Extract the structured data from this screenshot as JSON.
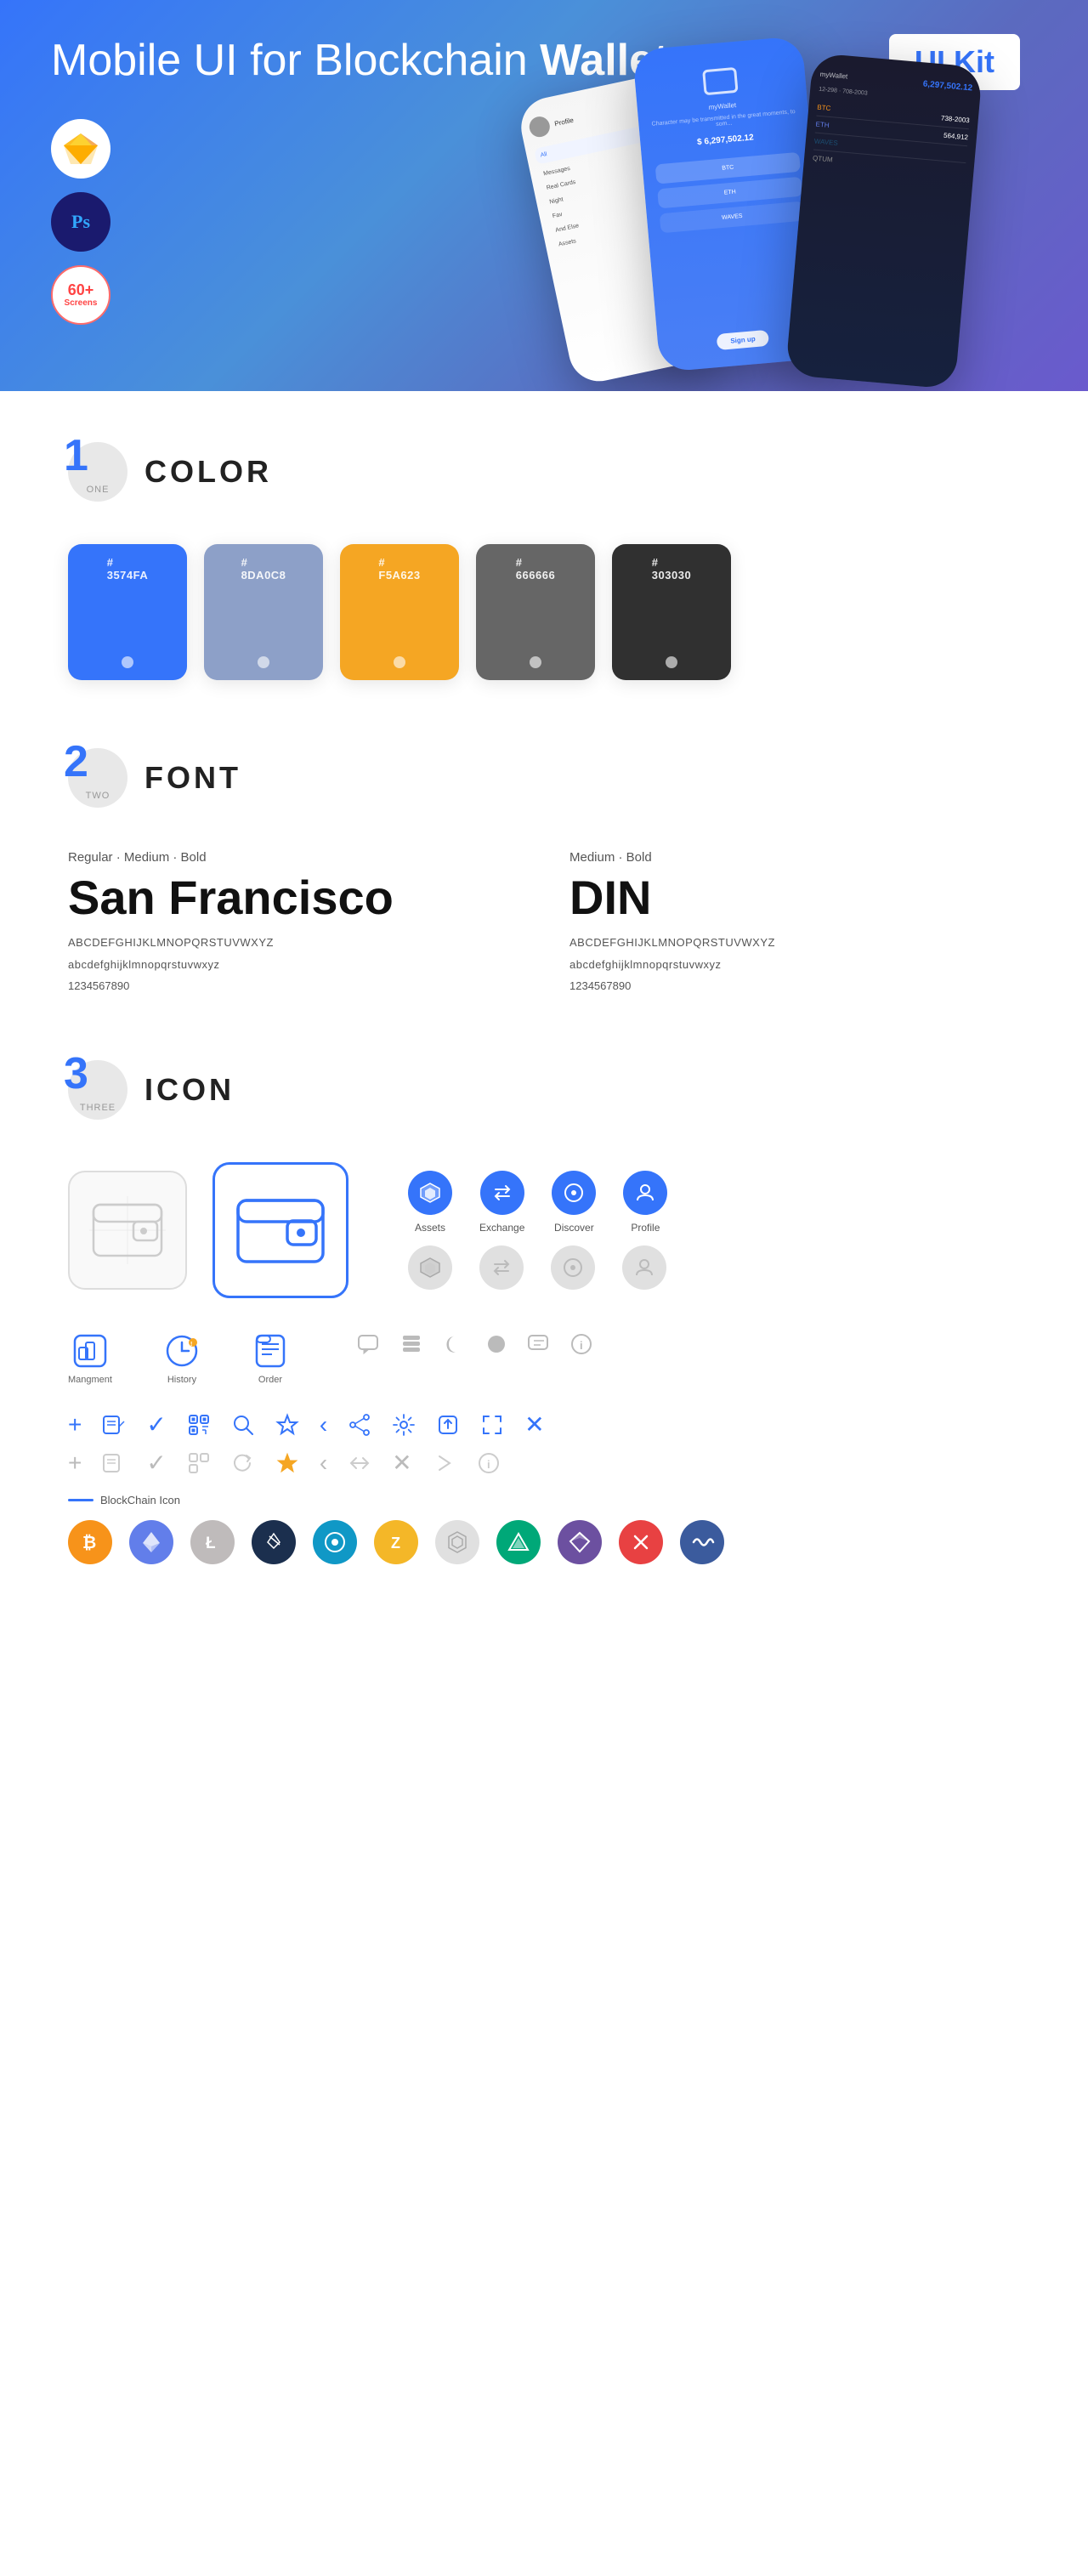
{
  "hero": {
    "title_normal": "Mobile UI for Blockchain ",
    "title_bold": "Wallet",
    "badge": "UI Kit",
    "sketch_label": "Sketch",
    "ps_label": "Ps",
    "screens_count": "60+",
    "screens_label": "Screens"
  },
  "section1": {
    "number": "1",
    "number_label": "ONE",
    "title": "COLOR",
    "colors": [
      {
        "hex": "#3574FA",
        "label": "3574FA"
      },
      {
        "hex": "#8DA0C8",
        "label": "8DA0C8"
      },
      {
        "hex": "#F5A623",
        "label": "F5A623"
      },
      {
        "hex": "#666666",
        "label": "666666"
      },
      {
        "hex": "#303030",
        "label": "303030"
      }
    ]
  },
  "section2": {
    "number": "2",
    "number_label": "TWO",
    "title": "FONT",
    "fonts": [
      {
        "style": "Regular · Medium · Bold",
        "name": "San Francisco",
        "uppercase": "ABCDEFGHIJKLMNOPQRSTUVWXYZ",
        "lowercase": "abcdefghijklmnopqrstuvwxyz",
        "numbers": "1234567890"
      },
      {
        "style": "Medium · Bold",
        "name": "DIN",
        "uppercase": "ABCDEFGHIJKLMNOPQRSTUVWXYZ",
        "lowercase": "abcdefghijklmnopqrstuvwxyz",
        "numbers": "1234567890"
      }
    ]
  },
  "section3": {
    "number": "3",
    "number_label": "THREE",
    "title": "ICON",
    "nav_icons": [
      {
        "label": "Assets",
        "color": "blue"
      },
      {
        "label": "Exchange",
        "color": "blue"
      },
      {
        "label": "Discover",
        "color": "blue"
      },
      {
        "label": "Profile",
        "color": "blue"
      }
    ],
    "bottom_icons": [
      {
        "label": "Mangment",
        "color": "blue"
      },
      {
        "label": "History",
        "color": "blue"
      },
      {
        "label": "Order",
        "color": "blue"
      }
    ],
    "blockchain_label": "BlockChain Icon",
    "crypto_icons": [
      {
        "symbol": "₿",
        "color": "#F7931A",
        "bg": "#fff",
        "name": "bitcoin"
      },
      {
        "symbol": "Ξ",
        "color": "#627EEA",
        "bg": "#fff",
        "name": "ethereum"
      },
      {
        "symbol": "Ł",
        "color": "#A0A0A0",
        "bg": "#fff",
        "name": "litecoin"
      },
      {
        "symbol": "◈",
        "color": "#1B2F4E",
        "bg": "#fff",
        "name": "neo"
      },
      {
        "symbol": "◎",
        "color": "#1098C6",
        "bg": "#fff",
        "name": "dash"
      },
      {
        "symbol": "Z",
        "color": "#F4B728",
        "bg": "#fff",
        "name": "zcash"
      },
      {
        "symbol": "⬡",
        "color": "#888",
        "bg": "#fff",
        "name": "grid"
      },
      {
        "symbol": "▲",
        "color": "#00A878",
        "bg": "#fff",
        "name": "waves"
      },
      {
        "symbol": "◆",
        "color": "#6C50A0",
        "bg": "#fff",
        "name": "qtum"
      },
      {
        "symbol": "×",
        "color": "#E84142",
        "bg": "#fff",
        "name": "avax"
      },
      {
        "symbol": "~",
        "color": "#3B5B9D",
        "bg": "#fff",
        "name": "polygon"
      }
    ]
  }
}
